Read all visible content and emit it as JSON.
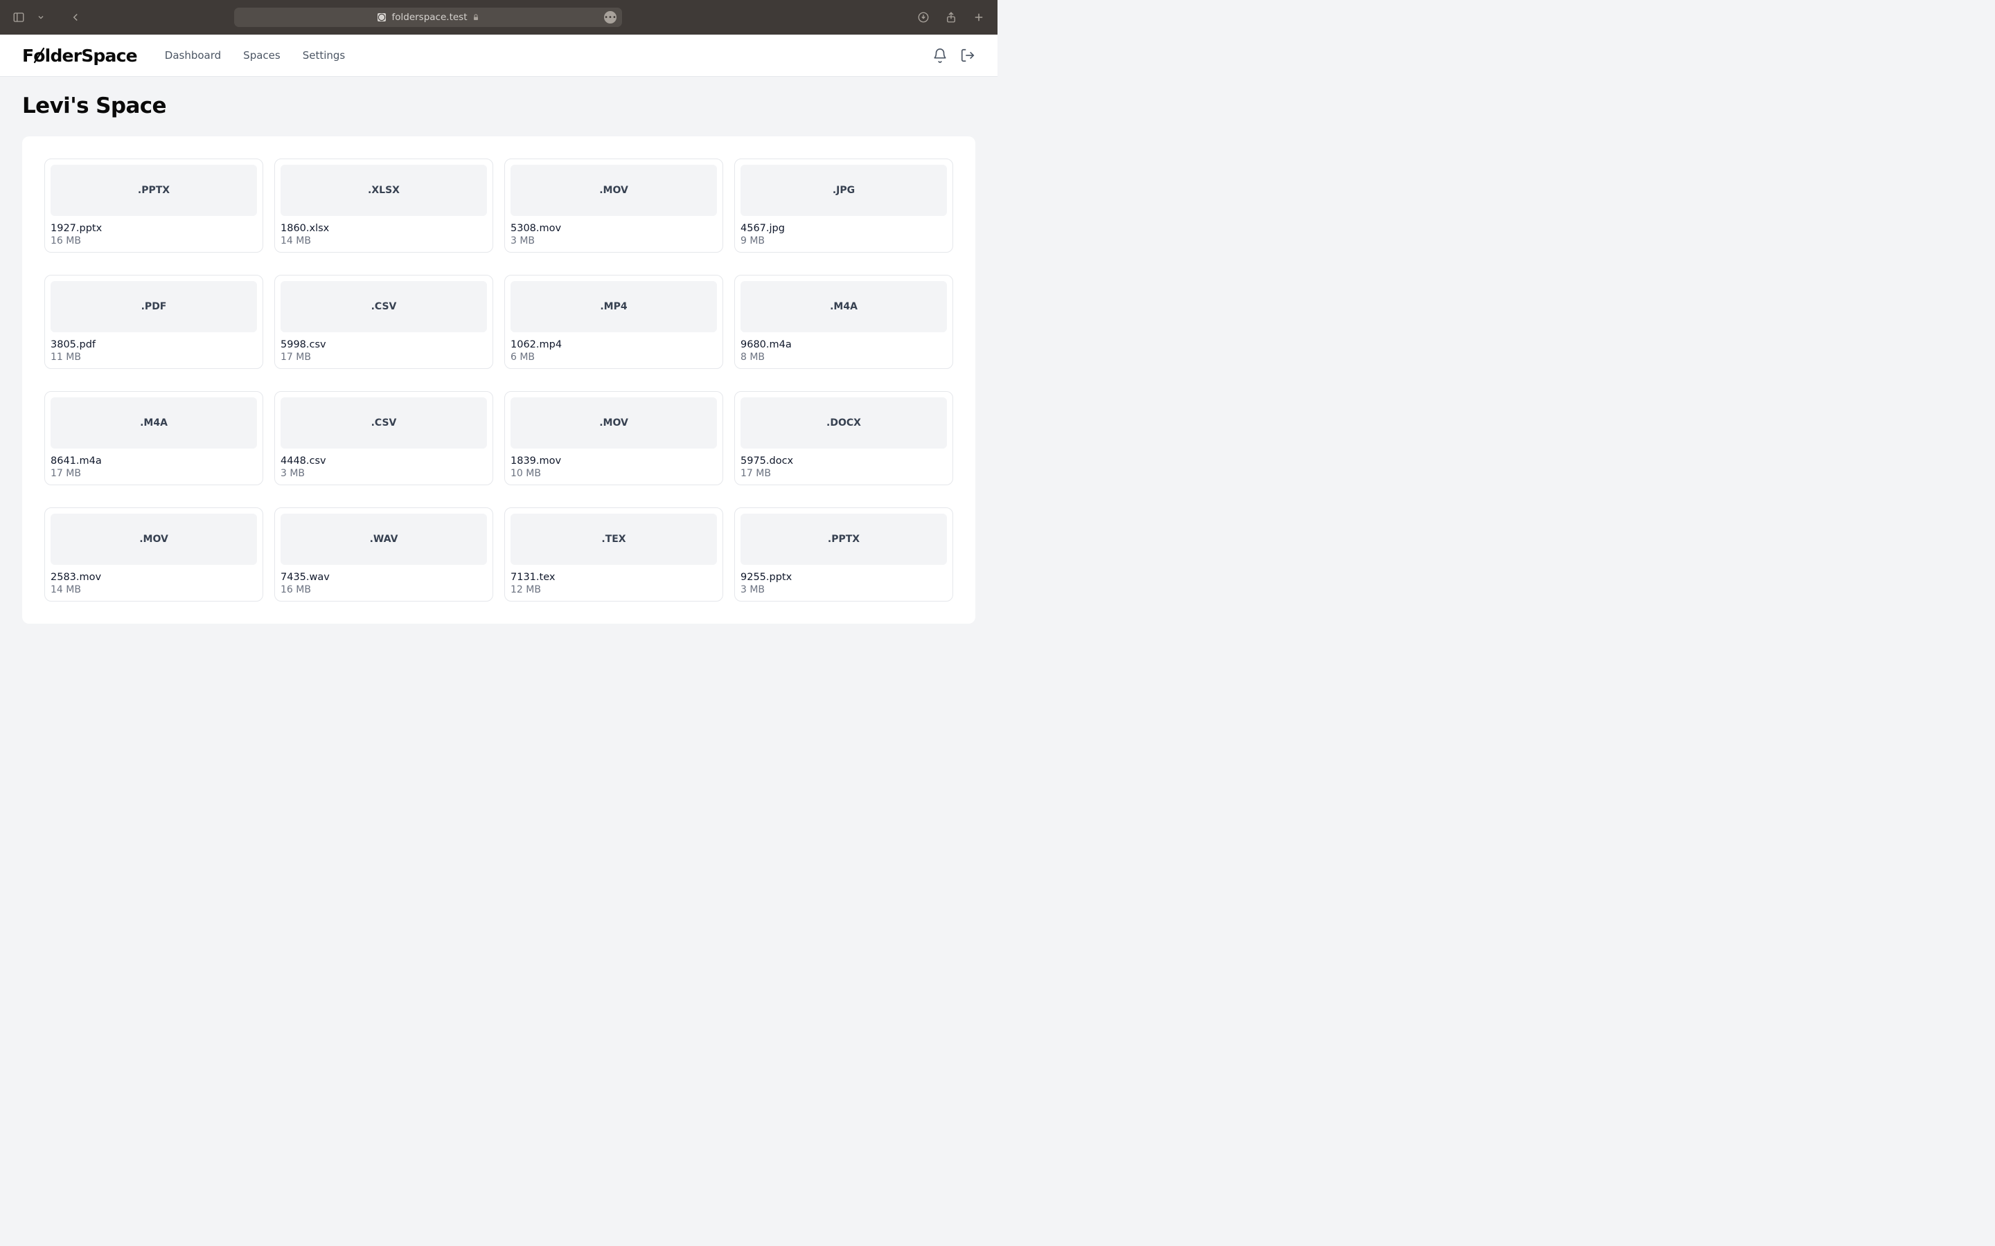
{
  "browser": {
    "url": "folderspace.test"
  },
  "brand": {
    "text": "FolderSpace"
  },
  "nav": {
    "items": [
      {
        "label": "Dashboard"
      },
      {
        "label": "Spaces"
      },
      {
        "label": "Settings"
      }
    ]
  },
  "page": {
    "title": "Levi's Space"
  },
  "files": [
    {
      "ext": ".PPTX",
      "name": "1927.pptx",
      "size": "16 MB"
    },
    {
      "ext": ".XLSX",
      "name": "1860.xlsx",
      "size": "14 MB"
    },
    {
      "ext": ".MOV",
      "name": "5308.mov",
      "size": "3 MB"
    },
    {
      "ext": ".JPG",
      "name": "4567.jpg",
      "size": "9 MB"
    },
    {
      "ext": ".PDF",
      "name": "3805.pdf",
      "size": "11 MB"
    },
    {
      "ext": ".CSV",
      "name": "5998.csv",
      "size": "17 MB"
    },
    {
      "ext": ".MP4",
      "name": "1062.mp4",
      "size": "6 MB"
    },
    {
      "ext": ".M4A",
      "name": "9680.m4a",
      "size": "8 MB"
    },
    {
      "ext": ".M4A",
      "name": "8641.m4a",
      "size": "17 MB"
    },
    {
      "ext": ".CSV",
      "name": "4448.csv",
      "size": "3 MB"
    },
    {
      "ext": ".MOV",
      "name": "1839.mov",
      "size": "10 MB"
    },
    {
      "ext": ".DOCX",
      "name": "5975.docx",
      "size": "17 MB"
    },
    {
      "ext": ".MOV",
      "name": "2583.mov",
      "size": "14 MB"
    },
    {
      "ext": ".WAV",
      "name": "7435.wav",
      "size": "16 MB"
    },
    {
      "ext": ".TEX",
      "name": "7131.tex",
      "size": "12 MB"
    },
    {
      "ext": ".PPTX",
      "name": "9255.pptx",
      "size": "3 MB"
    }
  ]
}
